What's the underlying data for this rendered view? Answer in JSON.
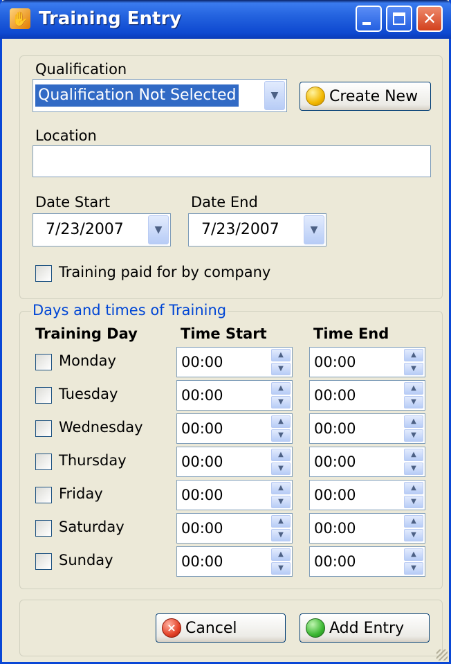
{
  "window": {
    "title": "Training Entry",
    "icon": "app-icon",
    "controls": [
      "minimize-icon",
      "maximize-icon",
      "close-icon"
    ]
  },
  "form": {
    "qualification_label": "Qualification",
    "qualification_value": "Qualification Not Selected",
    "create_new_label": "Create New",
    "location_label": "Location",
    "location_value": "",
    "date_start_label": "Date Start",
    "date_start_value": "7/23/2007",
    "date_end_label": "Date End",
    "date_end_value": "7/23/2007",
    "paid_by_company_label": "Training paid for by company",
    "paid_by_company_checked": false
  },
  "schedule": {
    "legend": "Days and times of Training",
    "headers": {
      "day": "Training Day",
      "start": "Time Start",
      "end": "Time End"
    },
    "days": [
      {
        "name": "Monday",
        "checked": false,
        "start": "00:00",
        "end": "00:00"
      },
      {
        "name": "Tuesday",
        "checked": false,
        "start": "00:00",
        "end": "00:00"
      },
      {
        "name": "Wednesday",
        "checked": false,
        "start": "00:00",
        "end": "00:00"
      },
      {
        "name": "Thursday",
        "checked": false,
        "start": "00:00",
        "end": "00:00"
      },
      {
        "name": "Friday",
        "checked": false,
        "start": "00:00",
        "end": "00:00"
      },
      {
        "name": "Saturday",
        "checked": false,
        "start": "00:00",
        "end": "00:00"
      },
      {
        "name": "Sunday",
        "checked": false,
        "start": "00:00",
        "end": "00:00"
      }
    ]
  },
  "actions": {
    "cancel_label": "Cancel",
    "add_entry_label": "Add Entry"
  },
  "colors": {
    "title_bar": "#0E49D0",
    "window_bg": "#ECE9D8",
    "legend_text": "#0046D5",
    "selection": "#316AC5"
  }
}
